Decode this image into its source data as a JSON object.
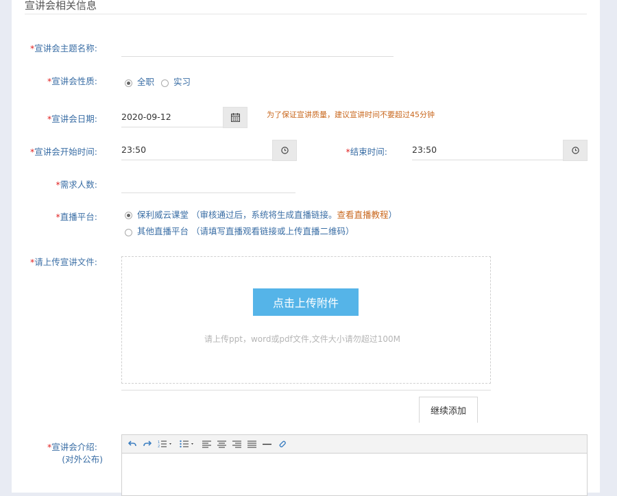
{
  "section": {
    "title": "宣讲会相关信息"
  },
  "required_mark": "*",
  "fields": {
    "topic": {
      "label": "宣讲会主题名称:",
      "value": ""
    },
    "nature": {
      "label": "宣讲会性质:",
      "options": [
        {
          "label": "全职",
          "selected": true
        },
        {
          "label": "实习",
          "selected": false
        }
      ]
    },
    "date": {
      "label": "宣讲会日期:",
      "value": "2020-09-12",
      "icon": "calendar-icon",
      "hint": "为了保证宣讲质量，建议宣讲时间不要超过45分钟"
    },
    "start_time": {
      "label": "宣讲会开始时间:",
      "value": "23:50",
      "icon": "clock-icon"
    },
    "end_time": {
      "label": "结束时间:",
      "value": "23:50",
      "icon": "clock-icon"
    },
    "headcount": {
      "label": "需求人数:",
      "value": ""
    },
    "platform": {
      "label": "直播平台:",
      "options": [
        {
          "label": "保利威云课堂",
          "note": "（审核通过后，系统将生成直播链接。",
          "link": "查看直播教程",
          "note_end": "）",
          "selected": true
        },
        {
          "label": "其他直播平台",
          "note": "（请填写直播观看链接或上传直播二维码）",
          "selected": false
        }
      ]
    },
    "upload": {
      "label": "请上传宣讲文件:",
      "button": "点击上传附件",
      "hint": "请上传ppt，word或pdf文件,文件大小请勿超过100M",
      "continue_button": "继续添加"
    },
    "intro": {
      "label": "宣讲会介绍:",
      "sublabel": "(对外公布)",
      "toolbar": [
        "undo-icon",
        "redo-icon",
        "ordered-list-icon",
        "unordered-list-icon",
        "align-left-icon",
        "align-center-icon",
        "align-right-icon",
        "align-justify-icon",
        "horizontal-rule-icon",
        "link-icon"
      ]
    }
  },
  "colors": {
    "label": "#3a6ea5",
    "required": "#e02020",
    "hint_orange": "#c9681f",
    "upload_button": "#55b4e8"
  }
}
